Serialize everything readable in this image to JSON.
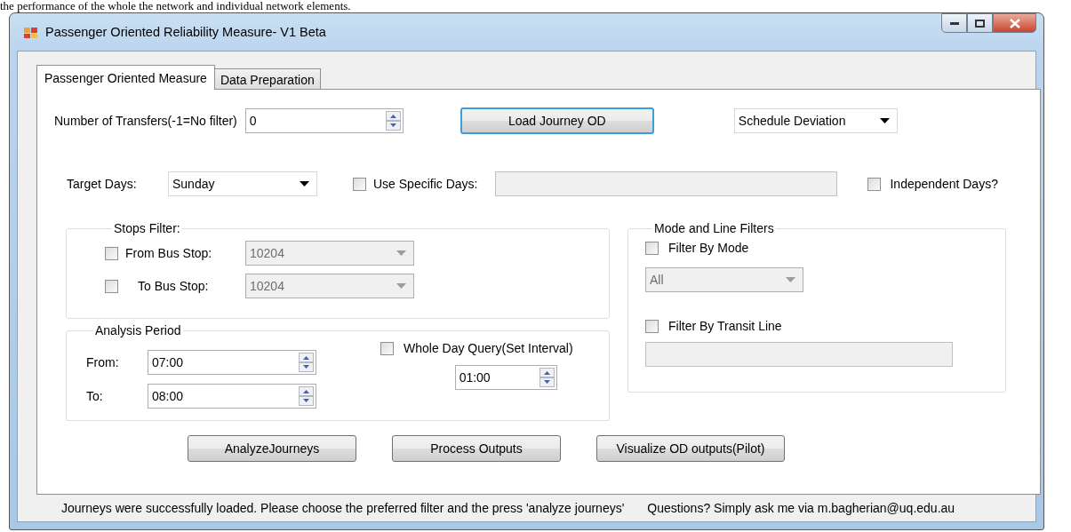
{
  "document_text": "the performance of the whole the network and individual network elements.",
  "window": {
    "title": "Passenger Oriented Reliability Measure- V1 Beta"
  },
  "tabs": [
    {
      "label": "Passenger Oriented Measure",
      "selected": true
    },
    {
      "label": "Data Preparation",
      "selected": false
    }
  ],
  "transfers": {
    "label": "Number of Transfers(-1=No filter)",
    "value": "0"
  },
  "load_button": {
    "label": "Load Journey OD",
    "focused": true
  },
  "measure_dropdown": {
    "value": "Schedule Deviation"
  },
  "target_days": {
    "label": "Target Days:",
    "value": "Sunday"
  },
  "specific_days": {
    "label": "Use Specific Days:",
    "checked": false,
    "field_disabled": true
  },
  "independent_days": {
    "label": "Independent Days?",
    "checked": false
  },
  "stops_filter": {
    "title": "Stops Filter:",
    "rows": [
      {
        "label": "From Bus Stop:",
        "checked": false,
        "value": "10204",
        "disabled": true
      },
      {
        "label": "To Bus Stop:",
        "checked": false,
        "value": "10204",
        "disabled": true
      }
    ]
  },
  "analysis_period": {
    "title": "Analysis Period",
    "from": {
      "label": "From:",
      "value": "07:00"
    },
    "to": {
      "label": "To:",
      "value": "08:00"
    },
    "whole_day": {
      "label": "Whole Day Query(Set Interval)",
      "checked": false
    },
    "interval": "01:00"
  },
  "mode_line_filters": {
    "title": "Mode and Line Filters",
    "filter_by_mode": {
      "label": "Filter By Mode",
      "checked": false
    },
    "mode_dropdown": {
      "value": "All",
      "disabled": true
    },
    "filter_by_line": {
      "label": "Filter By Transit Line",
      "checked": false
    },
    "line_field_disabled": true
  },
  "buttons": [
    {
      "label": "AnalyzeJourneys"
    },
    {
      "label": "Process Outputs"
    },
    {
      "label": "Visualize OD outputs(Pilot)"
    }
  ],
  "status_bar": {
    "message": "Journeys were successfully loaded. Please choose the preferred filter and the press 'analyze journeys'",
    "contact": "Questions? Simply ask me via m.bagherian@uq.edu.au"
  }
}
